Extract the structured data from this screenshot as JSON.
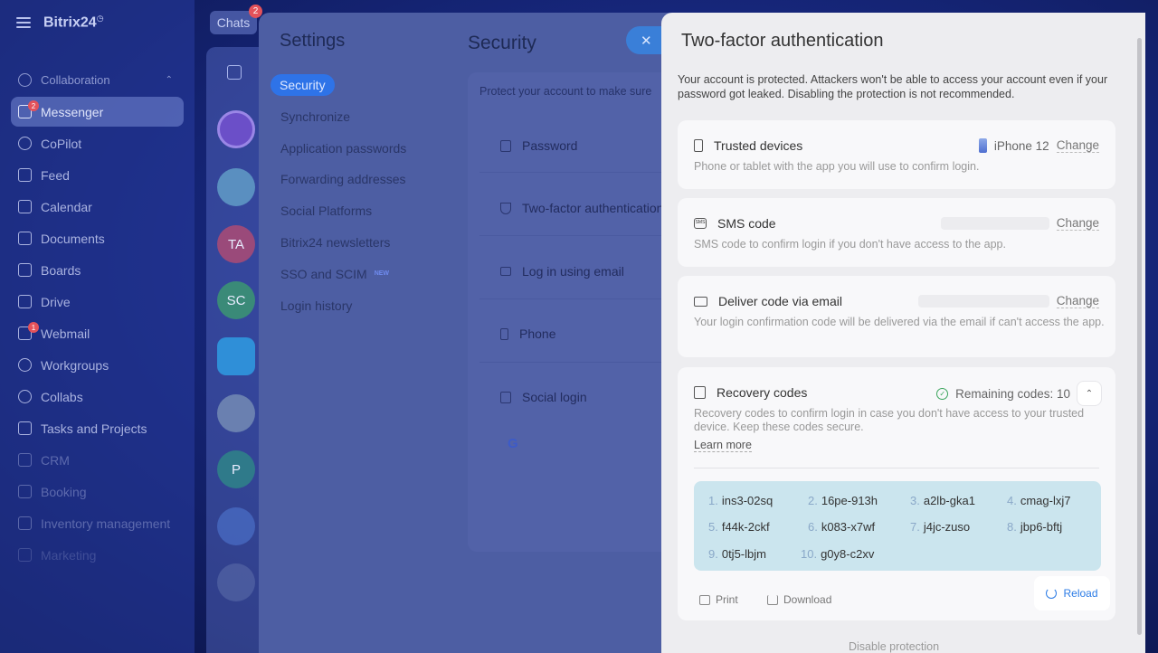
{
  "app": {
    "name": "Bitrix24",
    "logo_mark": "◷"
  },
  "sidebar": {
    "section_label": "Collaboration",
    "items": [
      {
        "label": "Messenger",
        "badge": "2"
      },
      {
        "label": "CoPilot"
      },
      {
        "label": "Feed"
      },
      {
        "label": "Calendar"
      },
      {
        "label": "Documents"
      },
      {
        "label": "Boards"
      },
      {
        "label": "Drive"
      },
      {
        "label": "Webmail",
        "badge": "1"
      },
      {
        "label": "Workgroups"
      },
      {
        "label": "Collabs"
      },
      {
        "label": "Tasks and Projects"
      },
      {
        "label": "CRM"
      },
      {
        "label": "Booking"
      },
      {
        "label": "Inventory management"
      },
      {
        "label": "Marketing"
      }
    ]
  },
  "chats": {
    "tab_label": "Chats",
    "badge": "2",
    "avatars": [
      "TA",
      "SC",
      "P"
    ]
  },
  "settings": {
    "title": "Settings",
    "menu": [
      {
        "label": "Security"
      },
      {
        "label": "Synchronize"
      },
      {
        "label": "Application passwords"
      },
      {
        "label": "Forwarding addresses"
      },
      {
        "label": "Social Platforms"
      },
      {
        "label": "Bitrix24 newsletters"
      },
      {
        "label": "SSO and SCIM",
        "badge": "NEW"
      },
      {
        "label": "Login history"
      }
    ]
  },
  "security": {
    "title": "Security",
    "intro": "Protect your account to make sure",
    "items": [
      {
        "label": "Password"
      },
      {
        "label": "Two-factor authentication"
      },
      {
        "label": "Log in using email"
      },
      {
        "label": "Phone"
      },
      {
        "label": "Social login"
      }
    ],
    "close_glyph": "✕",
    "google_glyph": "G"
  },
  "tfa": {
    "title": "Two-factor authentication",
    "description": "Your account is protected. Attackers won't be able to access your account even if your password got leaked. Disabling the protection is not recommended.",
    "trusted": {
      "title": "Trusted devices",
      "device": "iPhone 12",
      "change": "Change",
      "subtitle": "Phone or tablet with the app you will use to confirm login."
    },
    "sms": {
      "title": "SMS code",
      "icon_text": "SMS",
      "change": "Change",
      "subtitle": "SMS code to confirm login if you don't have access to the app."
    },
    "email": {
      "title": "Deliver code via email",
      "change": "Change",
      "subtitle": "Your login confirmation code will be delivered via the email if can't access the app."
    },
    "recovery": {
      "title": "Recovery codes",
      "remaining": "Remaining codes: 10",
      "subtitle": "Recovery codes to confirm login in case you don't have access to your trusted device. Keep these codes secure.",
      "learn_more": "Learn more",
      "codes": [
        {
          "n": "1.",
          "code": "ins3-02sq"
        },
        {
          "n": "2.",
          "code": "16pe-913h"
        },
        {
          "n": "3.",
          "code": "a2lb-gka1"
        },
        {
          "n": "4.",
          "code": "cmag-lxj7"
        },
        {
          "n": "5.",
          "code": "f44k-2ckf"
        },
        {
          "n": "6.",
          "code": "k083-x7wf"
        },
        {
          "n": "7.",
          "code": "j4jc-zuso"
        },
        {
          "n": "8.",
          "code": "jbp6-bftj"
        },
        {
          "n": "9.",
          "code": "0tj5-lbjm"
        },
        {
          "n": "10.",
          "code": "g0y8-c2xv"
        }
      ],
      "print": "Print",
      "download": "Download",
      "reload": "Reload"
    },
    "disable": "Disable protection"
  }
}
